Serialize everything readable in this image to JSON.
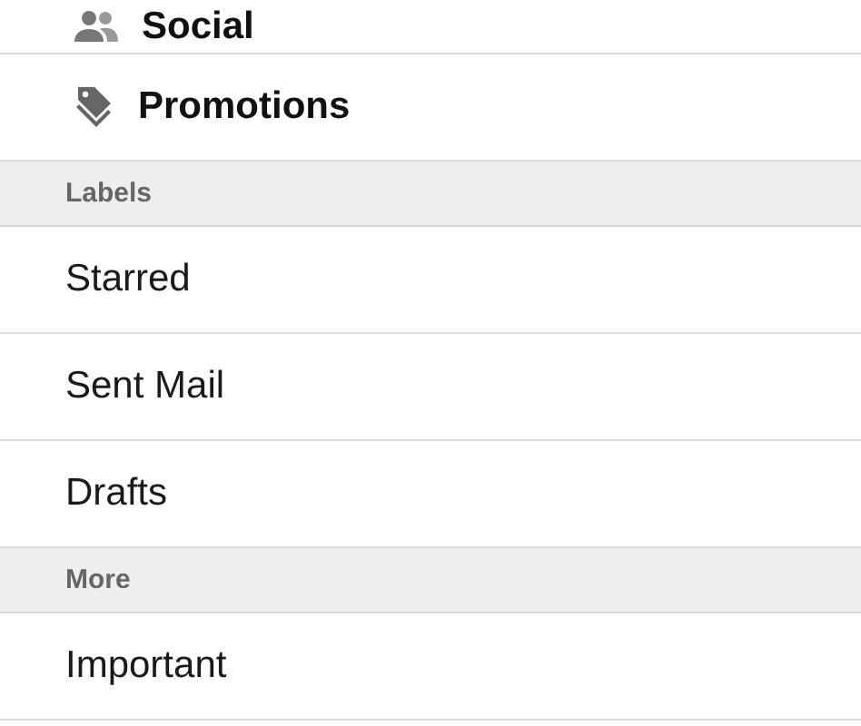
{
  "rows": [
    {
      "kind": "category",
      "label": "Social"
    },
    {
      "kind": "category",
      "label": "Promotions"
    },
    {
      "kind": "header",
      "label": "Labels"
    },
    {
      "kind": "item",
      "label": "Starred"
    },
    {
      "kind": "item",
      "label": "Sent Mail"
    },
    {
      "kind": "item",
      "label": "Drafts"
    },
    {
      "kind": "header",
      "label": "More"
    },
    {
      "kind": "item",
      "label": "Important"
    }
  ]
}
